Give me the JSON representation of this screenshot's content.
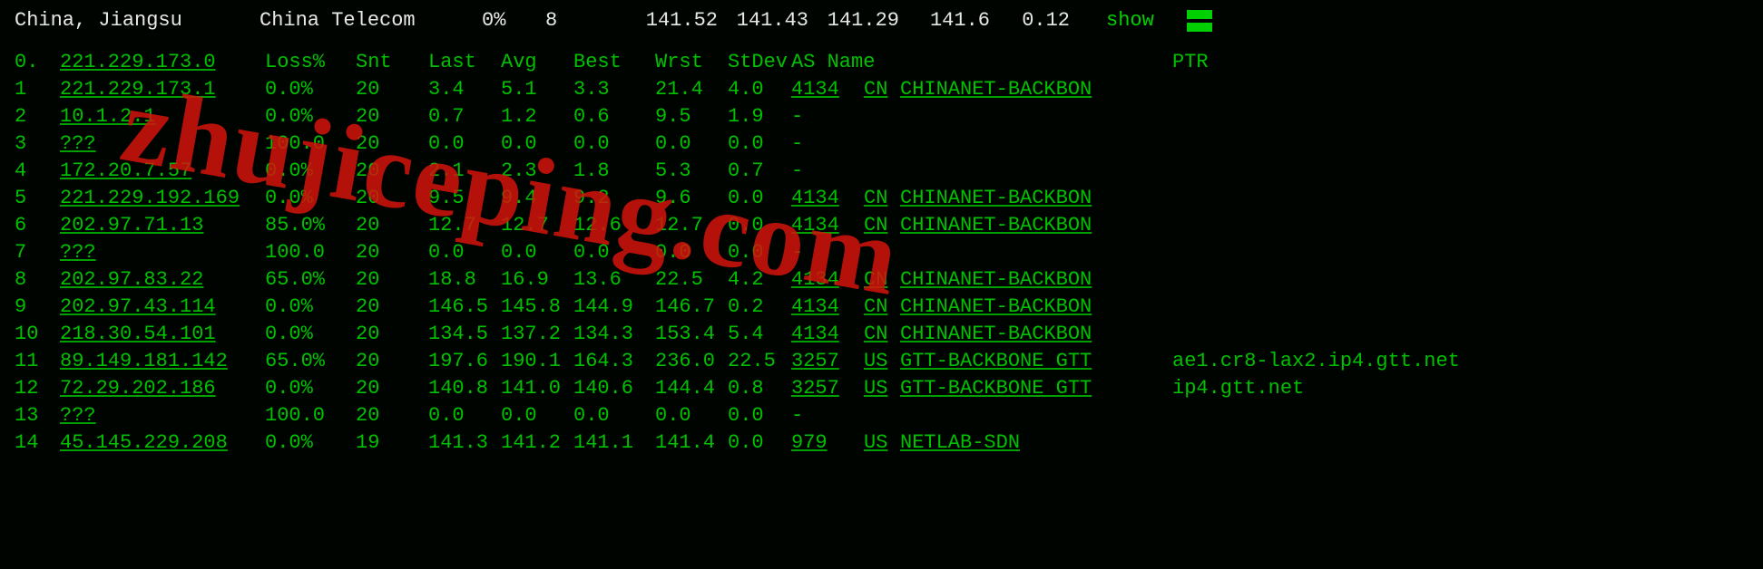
{
  "summary": {
    "location": "China, Jiangsu",
    "isp": "China Telecom",
    "loss": "0%",
    "sent": "8",
    "pings": [
      "141.52",
      "141.43",
      "141.29",
      "141.6"
    ],
    "stdev": "0.12",
    "show_label": "show"
  },
  "headers": {
    "idx": "0.",
    "ip": "221.229.173.0",
    "loss": "Loss%",
    "snt": "Snt",
    "last": "Last",
    "avg": "Avg",
    "best": "Best",
    "wrst": "Wrst",
    "stdev": "StDev",
    "asname": "AS Name",
    "ptr": "PTR"
  },
  "hops": [
    {
      "idx": "1",
      "ip": "221.229.173.1",
      "loss": "0.0%",
      "snt": "20",
      "last": "3.4",
      "avg": "5.1",
      "best": "3.3",
      "wrst": "21.4",
      "stdev": "4.0",
      "as": "4134",
      "cc": "CN",
      "asname": "CHINANET-BACKBON",
      "ptr": ""
    },
    {
      "idx": "2",
      "ip": "10.1.2.1",
      "loss": "0.0%",
      "snt": "20",
      "last": "0.7",
      "avg": "1.2",
      "best": "0.6",
      "wrst": "9.5",
      "stdev": "1.9",
      "as": "-",
      "cc": "",
      "asname": "",
      "ptr": ""
    },
    {
      "idx": "3",
      "ip": "???",
      "loss": "100.0",
      "snt": "20",
      "last": "0.0",
      "avg": "0.0",
      "best": "0.0",
      "wrst": "0.0",
      "stdev": "0.0",
      "as": "-",
      "cc": "",
      "asname": "",
      "ptr": ""
    },
    {
      "idx": "4",
      "ip": "172.20.7.57",
      "loss": "0.0%",
      "snt": "20",
      "last": "2.1",
      "avg": "2.3",
      "best": "1.8",
      "wrst": "5.3",
      "stdev": "0.7",
      "as": "-",
      "cc": "",
      "asname": "",
      "ptr": ""
    },
    {
      "idx": "5",
      "ip": "221.229.192.169",
      "loss": "0.0%",
      "snt": "20",
      "last": "9.5",
      "avg": "9.4",
      "best": "9.2",
      "wrst": "9.6",
      "stdev": "0.0",
      "as": "4134",
      "cc": "CN",
      "asname": "CHINANET-BACKBON",
      "ptr": ""
    },
    {
      "idx": "6",
      "ip": "202.97.71.13",
      "loss": "85.0%",
      "snt": "20",
      "last": "12.7",
      "avg": "12.7",
      "best": "12.6",
      "wrst": "12.7",
      "stdev": "0.0",
      "as": "4134",
      "cc": "CN",
      "asname": "CHINANET-BACKBON",
      "ptr": ""
    },
    {
      "idx": "7",
      "ip": "???",
      "loss": "100.0",
      "snt": "20",
      "last": "0.0",
      "avg": "0.0",
      "best": "0.0",
      "wrst": "0.0",
      "stdev": "0.0",
      "as": "-",
      "cc": "",
      "asname": "",
      "ptr": ""
    },
    {
      "idx": "8",
      "ip": "202.97.83.22",
      "loss": "65.0%",
      "snt": "20",
      "last": "18.8",
      "avg": "16.9",
      "best": "13.6",
      "wrst": "22.5",
      "stdev": "4.2",
      "as": "4134",
      "cc": "CN",
      "asname": "CHINANET-BACKBON",
      "ptr": ""
    },
    {
      "idx": "9",
      "ip": "202.97.43.114",
      "loss": "0.0%",
      "snt": "20",
      "last": "146.5",
      "avg": "145.8",
      "best": "144.9",
      "wrst": "146.7",
      "stdev": "0.2",
      "as": "4134",
      "cc": "CN",
      "asname": "CHINANET-BACKBON",
      "ptr": ""
    },
    {
      "idx": "10",
      "ip": "218.30.54.101",
      "loss": "0.0%",
      "snt": "20",
      "last": "134.5",
      "avg": "137.2",
      "best": "134.3",
      "wrst": "153.4",
      "stdev": "5.4",
      "as": "4134",
      "cc": "CN",
      "asname": "CHINANET-BACKBON",
      "ptr": ""
    },
    {
      "idx": "11",
      "ip": "89.149.181.142",
      "loss": "65.0%",
      "snt": "20",
      "last": "197.6",
      "avg": "190.1",
      "best": "164.3",
      "wrst": "236.0",
      "stdev": "22.5",
      "as": "3257",
      "cc": "US",
      "asname": "GTT-BACKBONE GTT",
      "ptr": "ae1.cr8-lax2.ip4.gtt.net"
    },
    {
      "idx": "12",
      "ip": "72.29.202.186",
      "loss": "0.0%",
      "snt": "20",
      "last": "140.8",
      "avg": "141.0",
      "best": "140.6",
      "wrst": "144.4",
      "stdev": "0.8",
      "as": "3257",
      "cc": "US",
      "asname": "GTT-BACKBONE GTT",
      "ptr": "ip4.gtt.net"
    },
    {
      "idx": "13",
      "ip": "???",
      "loss": "100.0",
      "snt": "20",
      "last": "0.0",
      "avg": "0.0",
      "best": "0.0",
      "wrst": "0.0",
      "stdev": "0.0",
      "as": "-",
      "cc": "",
      "asname": "",
      "ptr": ""
    },
    {
      "idx": "14",
      "ip": "45.145.229.208",
      "loss": "0.0%",
      "snt": "19",
      "last": "141.3",
      "avg": "141.2",
      "best": "141.1",
      "wrst": "141.4",
      "stdev": "0.0",
      "as": "979",
      "cc": "US",
      "asname": "NETLAB-SDN",
      "ptr": ""
    }
  ],
  "watermark": "zhujiceping.com"
}
